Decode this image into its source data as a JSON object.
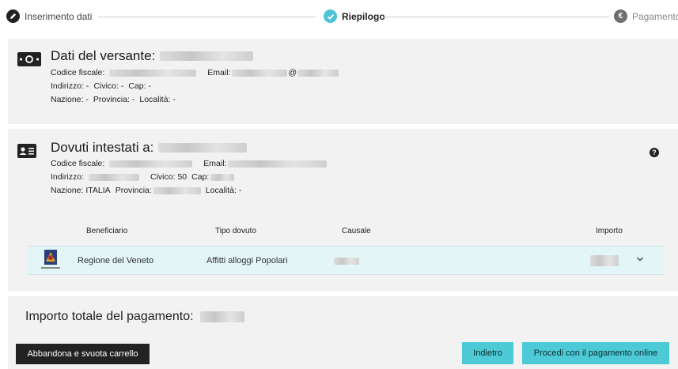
{
  "stepper": {
    "steps": [
      {
        "label": "Inserimento dati",
        "state": "done"
      },
      {
        "label": "Riepilogo",
        "state": "active"
      },
      {
        "label": "Pagamento",
        "state": "pending"
      }
    ]
  },
  "payer": {
    "heading": "Dati del versante:",
    "codice_fiscale_label": "Codice fiscale:",
    "email_label": "Email:",
    "email_partial": "@",
    "indirizzo": "Indirizzo: -",
    "civico": "Civico: -",
    "cap": "Cap: -",
    "nazione": "Nazione: -",
    "provincia": "Provincia: -",
    "localita": "Località: -"
  },
  "debtor": {
    "heading": "Dovuti intestati a:",
    "codice_fiscale_label": "Codice fiscale:",
    "email_label": "Email:",
    "indirizzo_label": "Indirizzo:",
    "civico": "Civico: 50",
    "cap_label": "Cap:",
    "nazione": "Nazione: ITALIA",
    "provincia_label": "Provincia:",
    "localita": "Località: -"
  },
  "table": {
    "columns": [
      "Beneficiario",
      "Tipo dovuto",
      "Causale",
      "Importo"
    ],
    "rows": [
      {
        "beneficiario": "Regione del Veneto",
        "tipo_dovuto": "Affitti alloggi Popolari",
        "logo_caption": "REGIONE DEL VENETO"
      }
    ]
  },
  "total": {
    "label": "Importo totale del pagamento:"
  },
  "buttons": {
    "abandon": "Abbandona e svuota carrello",
    "back": "Indietro",
    "proceed": "Procedi con il pagamento online"
  },
  "icons": {
    "step1": "pencil-icon",
    "step2": "check-icon",
    "step3": "euro-icon",
    "payer": "money-icon",
    "debtor": "id-card-icon",
    "help": "question-icon",
    "expand": "chevron-down-icon"
  },
  "colors": {
    "accent": "#4ccbd6",
    "panel": "#f2f2f2",
    "row_highlight": "#e3f5f6",
    "dark_button": "#222222"
  }
}
